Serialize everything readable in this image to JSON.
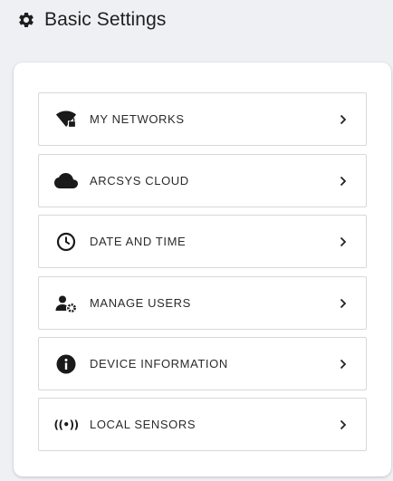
{
  "header": {
    "icon": "gear-icon",
    "title": "Basic Settings"
  },
  "menu": {
    "items": [
      {
        "label": "MY NETWORKS",
        "icon": "wifi-lock-icon"
      },
      {
        "label": "ARCSYS CLOUD",
        "icon": "cloud-icon"
      },
      {
        "label": "DATE AND TIME",
        "icon": "clock-icon"
      },
      {
        "label": "MANAGE USERS",
        "icon": "user-gear-icon"
      },
      {
        "label": "DEVICE INFORMATION",
        "icon": "info-icon"
      },
      {
        "label": "LOCAL SENSORS",
        "icon": "sensor-broadcast-icon",
        "glyph": "((•))"
      }
    ],
    "chevron_icon": "chevron-right-icon"
  },
  "colors": {
    "background": "#eff0f4",
    "card": "#ffffff",
    "icon": "#1a1a1a",
    "border": "#d8d8d8"
  }
}
